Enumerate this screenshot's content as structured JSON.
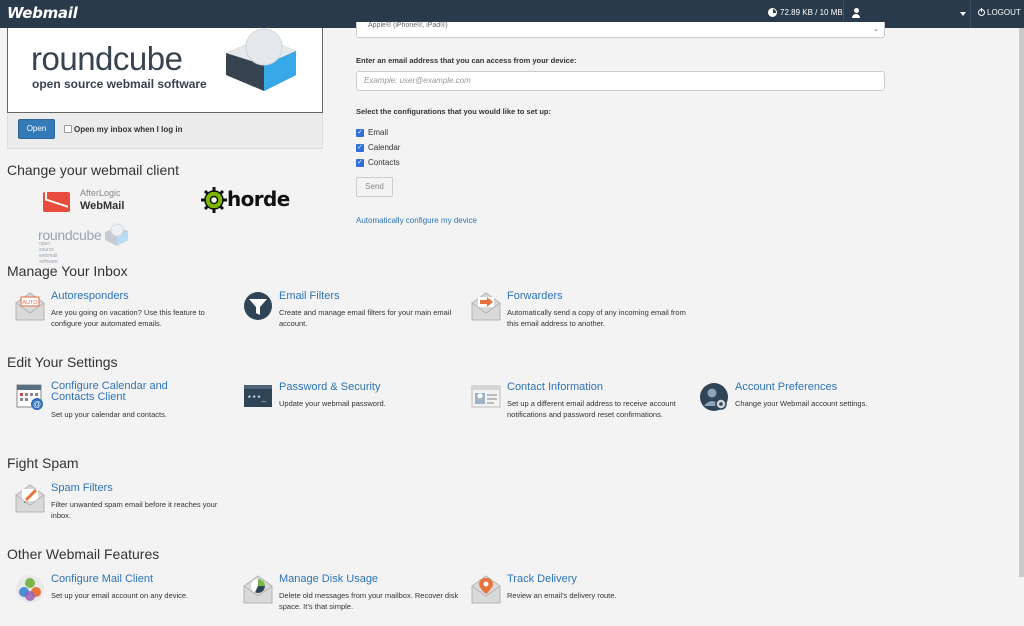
{
  "header": {
    "brand": "Webmail",
    "disk_usage": "72.89 KB / 10 MB",
    "logout_label": "LOGOUT"
  },
  "default_client": {
    "logo_title": "roundcube",
    "logo_subtitle": "open source webmail software",
    "open_button": "Open",
    "open_on_login_label": "Open my inbox when I log in"
  },
  "change_client": {
    "title": "Change your webmail client",
    "afterlogic_line1": "AfterLogic",
    "afterlogic_line2": "WebMail",
    "horde_label": "horde",
    "roundcube_small": "roundcube",
    "roundcube_small_sub": "open source webmail software"
  },
  "device_setup": {
    "device_select_value": "Apple® (iPhone®, iPad®)",
    "email_label": "Enter an email address that you can access from your device:",
    "email_placeholder": "Example: user@example.com",
    "config_label": "Select the configurations that you would like to set up:",
    "options": [
      "Email",
      "Calendar",
      "Contacts"
    ],
    "send_button": "Send",
    "auto_link": "Automatically configure my device"
  },
  "sections": {
    "manage_inbox": {
      "title": "Manage Your Inbox",
      "items": [
        {
          "title": "Autoresponders",
          "desc": "Are you going on vacation? Use this feature to configure your automated emails.",
          "icon": "autoresponder-icon"
        },
        {
          "title": "Email Filters",
          "desc": "Create and manage email filters for your main email account.",
          "icon": "email-filter-icon"
        },
        {
          "title": "Forwarders",
          "desc": "Automatically send a copy of any incoming email from this email address to another.",
          "icon": "forwarder-icon"
        }
      ]
    },
    "edit_settings": {
      "title": "Edit Your Settings",
      "items": [
        {
          "title": "Configure Calendar and Contacts Client",
          "desc": "Set up your calendar and contacts.",
          "icon": "calendar-contacts-icon"
        },
        {
          "title": "Password & Security",
          "desc": "Update your webmail password.",
          "icon": "password-icon"
        },
        {
          "title": "Contact Information",
          "desc": "Set up a different email address to receive account notifications and password reset confirmations.",
          "icon": "contact-info-icon"
        },
        {
          "title": "Account Preferences",
          "desc": "Change your Webmail account settings.",
          "icon": "account-preferences-icon"
        }
      ]
    },
    "fight_spam": {
      "title": "Fight Spam",
      "items": [
        {
          "title": "Spam Filters",
          "desc": "Filter unwanted spam email before it reaches your inbox.",
          "icon": "spam-filter-icon"
        }
      ]
    },
    "other_features": {
      "title": "Other Webmail Features",
      "items": [
        {
          "title": "Configure Mail Client",
          "desc": "Set up your email account on any device.",
          "icon": "mail-client-icon"
        },
        {
          "title": "Manage Disk Usage",
          "desc": "Delete old messages from your mailbox. Recover disk space. It’s that simple.",
          "icon": "disk-usage-icon"
        },
        {
          "title": "Track Delivery",
          "desc": "Review an email’s delivery route.",
          "icon": "track-delivery-icon"
        }
      ]
    }
  }
}
